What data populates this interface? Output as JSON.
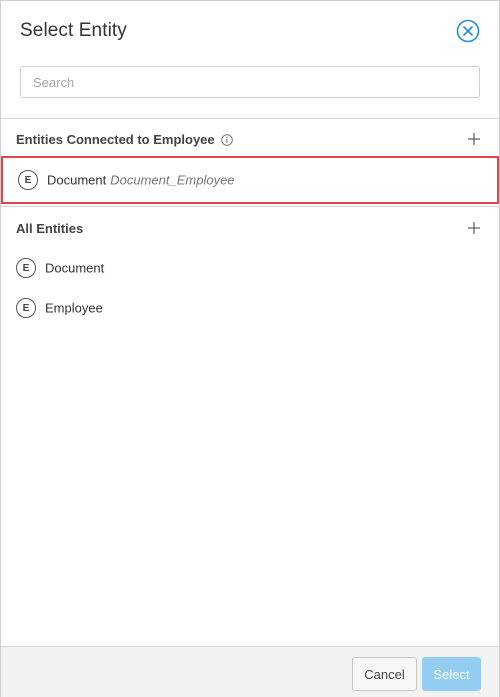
{
  "dialog": {
    "title": "Select Entity",
    "close_icon": "close-circle-icon"
  },
  "search": {
    "placeholder": "Search",
    "value": ""
  },
  "connected_section": {
    "title": "Entities Connected to Employee",
    "info_icon": "info-icon",
    "add_icon": "plus-icon",
    "items": [
      {
        "badge": "E",
        "name": "Document",
        "relation": "Document_Employee",
        "selected": true
      }
    ]
  },
  "all_section": {
    "title": "All Entities",
    "add_icon": "plus-icon",
    "items": [
      {
        "badge": "E",
        "name": "Document"
      },
      {
        "badge": "E",
        "name": "Employee"
      }
    ]
  },
  "footer": {
    "cancel_label": "Cancel",
    "select_label": "Select"
  },
  "colors": {
    "accent": "#1e8ed8",
    "highlight_border": "#e8424a",
    "select_button_disabled": "#93cdf2",
    "footer_bg": "#f2f2f2"
  }
}
